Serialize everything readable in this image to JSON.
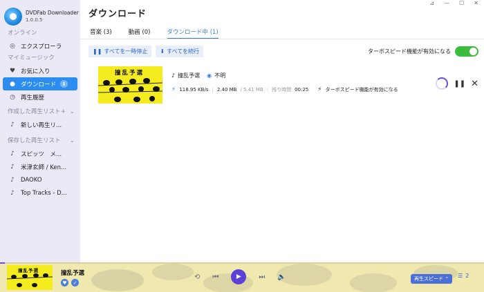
{
  "app": {
    "name": "DVDFab Downloader",
    "version": "1.0.0.5"
  },
  "window_controls": [
    "⊿",
    "—",
    "☐",
    "✕"
  ],
  "sidebar": {
    "online_label": "オンライン",
    "explorer": "エクスプローラ",
    "my_music_label": "マイミュージック",
    "favorites": "お気に入り",
    "download": "ダウンロード",
    "history": "再生履歴",
    "created_playlists_label": "作成した再生リスト",
    "new_playlist": "新しい再生リ...",
    "saved_playlists_label": "保存した再生リスト",
    "saved_playlists": [
      "スピッツ　メ...",
      "米津玄師 / Ken...",
      "DAOKO",
      "Top Tracks - D..."
    ]
  },
  "main": {
    "title": "ダウンロード",
    "tabs": [
      {
        "label": "音楽 (3)"
      },
      {
        "label": "動画 (0)"
      },
      {
        "label": "ダウンロード中 (1)"
      }
    ],
    "pause_all": "すべてを一時停止",
    "resume_all": "すべてを続行",
    "turbo_label": "ターボスピード機能が有効になる",
    "turbo_enabled": true
  },
  "download_item": {
    "thumb_text": "撞乱予選",
    "title": "撞乱予選",
    "artist": "不明",
    "speed": "118.95 KB/s",
    "downloaded": "2.40 MB",
    "total": "/ 5.41 MB",
    "remaining_label": "残り時間",
    "remaining": "00:25",
    "turbo_note": "ターボスピード機能が有効になる"
  },
  "player": {
    "thumb_text": "撞乱予選",
    "title": "撞乱予選",
    "speed_label": "再生スピード",
    "queue_count": "2",
    "progress": 0.01
  },
  "colors": {
    "accent": "#2c8df0",
    "play": "#5b3fd6",
    "toggle": "#3cbc3c",
    "thumb": "#f4ec1e"
  }
}
